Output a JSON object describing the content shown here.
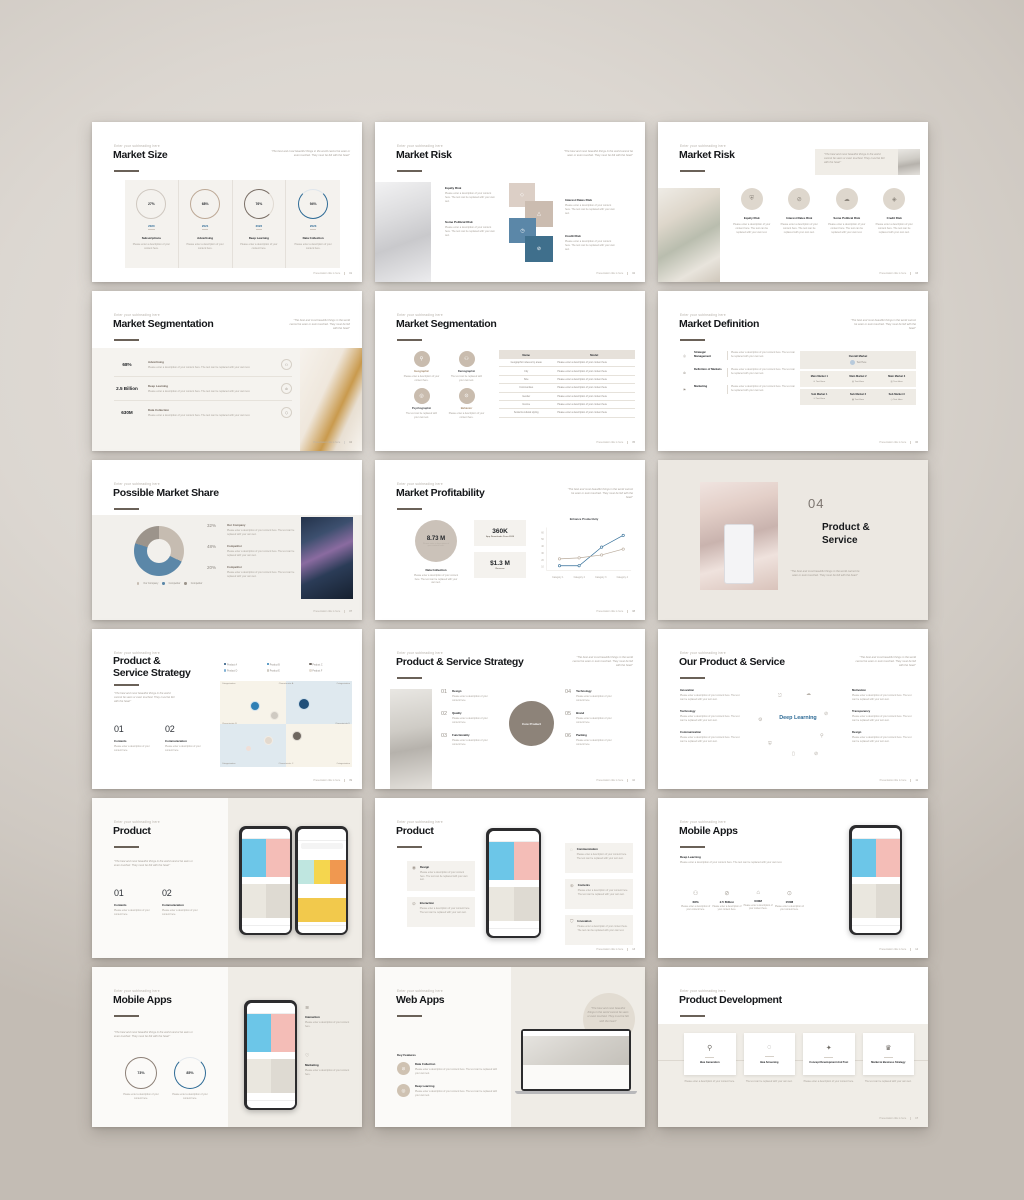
{
  "meta": {
    "eyebrow": "Enter your subheading here",
    "quote": "\"The best and most beautiful things in the world cannot be seen or even touched. They must be felt with the heart\"",
    "body_text": "Please enter a description of your content here. The text can be replaced with your own text.",
    "body_short": "Please enter a description of your content here.",
    "body_alt": "The text can be replaced with your own text.",
    "footer_label": "Presentation title is here",
    "colors": {
      "ink": "#15171a",
      "muted": "#a8a29a",
      "band": "#f3f1ed",
      "accent_blue": "#2e6b96",
      "accent_steel": "#5b87a8",
      "accent_taupe": "#c9bcae",
      "accent_gray": "#8d8880"
    }
  },
  "slides": [
    {
      "id": "market-size",
      "title": "Market Size",
      "page": "01",
      "chart_data": {
        "type": "pie",
        "title": "Market Size",
        "categories": [
          "2020",
          "2021",
          "2022",
          "2023"
        ],
        "labels": [
          "Subscriptions",
          "Advertising",
          "Deep Learning",
          "Data Collection"
        ],
        "values": [
          27,
          68,
          76,
          94
        ],
        "value_labels": [
          "27%",
          "68%",
          "76%",
          "94%"
        ],
        "colors": [
          "#cfc8c0",
          "#bda996",
          "#7a6f66",
          "#2e6b96"
        ]
      }
    },
    {
      "id": "market-risk-a",
      "title": "Market Risk",
      "page": "02",
      "items": [
        {
          "label": "Equity Risk"
        },
        {
          "label": "Some Political Risk"
        },
        {
          "label": "Interest Rates Risk"
        },
        {
          "label": "Credit Risk"
        }
      ],
      "tiles": [
        "#dccfc6",
        "#cbbcb0",
        "#5b87a8",
        "#3f6f8c"
      ]
    },
    {
      "id": "market-risk-b",
      "title": "Market Risk",
      "page": "03",
      "items": [
        {
          "label": "Equity Risk"
        },
        {
          "label": "Interest Rates Risk"
        },
        {
          "label": "Some Political Risk"
        },
        {
          "label": "Credit Risk"
        }
      ]
    },
    {
      "id": "market-segmentation-a",
      "title": "Market Segmentation",
      "page": "04",
      "rows": [
        {
          "value": "68%",
          "label": "Advertising"
        },
        {
          "value": "2.5 Billion",
          "label": "Deep Learning"
        },
        {
          "value": "630M",
          "label": "Data Collection"
        }
      ]
    },
    {
      "id": "market-segmentation-b",
      "title": "Market Segmentation",
      "page": "05",
      "items": [
        {
          "label": "Geographic"
        },
        {
          "label": "Demographic"
        },
        {
          "label": "Psychographic"
        },
        {
          "label": "Behavior"
        }
      ],
      "table": {
        "headers": [
          "Name",
          "Model"
        ],
        "rows": [
          [
            "Geographic indexes by areas",
            "Please enter a description of your content here"
          ],
          [
            "City",
            "Please enter a description of your content here"
          ],
          [
            "Size",
            "Please enter a description of your content here"
          ],
          [
            "Communities",
            "Please enter a description of your content here"
          ],
          [
            "Gender",
            "Please enter a description of your content here"
          ],
          [
            "Income",
            "Please enter a description of your content here"
          ],
          [
            "Social & cultural styling",
            "Please enter a description of your content here"
          ]
        ]
      }
    },
    {
      "id": "market-definition",
      "title": "Market Definition",
      "page": "06",
      "rows": [
        {
          "label": "Strategic Management"
        },
        {
          "label": "Definition of Markets"
        },
        {
          "label": "Marketing"
        }
      ],
      "matrix": {
        "overall": "Overall Market",
        "main": [
          "Main Market 1",
          "Main Market 2",
          "Main Market 3"
        ],
        "sub": [
          "Sub Market 1",
          "Sub Market 2",
          "Sub Market 3"
        ],
        "cell_label": "Text Here"
      }
    },
    {
      "id": "possible-market-share",
      "title": "Possible Market Share",
      "page": "07",
      "chart_data": {
        "type": "pie",
        "title": "Possible Market Share",
        "categories": [
          "Our Company",
          "Competitor",
          "Competitor"
        ],
        "values": [
          32,
          48,
          20
        ],
        "value_labels": [
          "32%",
          "48%",
          "20%"
        ],
        "colors": [
          "#c6bcb1",
          "#5b87a8",
          "#9c948b"
        ],
        "legend": [
          "Our Company",
          "Competitor",
          "Competitor"
        ],
        "legend_position": "bottom"
      }
    },
    {
      "id": "market-profitability",
      "title": "Market Profitability",
      "page": "08",
      "kpis": [
        {
          "value": "8.73 M",
          "label": "Data Collection"
        },
        {
          "value": "360K",
          "label": "App Downloads  From 2020"
        },
        {
          "value": "$1.3 M",
          "label": "Revenue"
        }
      ],
      "chart_data": {
        "type": "line",
        "title": "Enhance Productivity",
        "categories": [
          "Category 1",
          "Category 2",
          "Category 3",
          "Category 4"
        ],
        "series": [
          {
            "name": "Series 1",
            "values": [
              12,
              12,
              40,
              58
            ],
            "color": "#2e6b96"
          },
          {
            "name": "Series 2",
            "values": [
              22,
              23,
              27,
              36
            ],
            "color": "#b9ab9c"
          }
        ],
        "ylim": [
          0,
          65
        ],
        "yticks": [
          10,
          20,
          30,
          40,
          50,
          60
        ],
        "grid": false
      }
    },
    {
      "id": "section-product-service",
      "number": "04",
      "title": "Product & Service",
      "title_lines": [
        "Product &",
        "Service"
      ]
    },
    {
      "id": "product-service-strategy-a",
      "title_lines": [
        "Product &",
        "Service Strategy"
      ],
      "page": "09",
      "legend": [
        "Product A",
        "Product B",
        "Product C",
        "Product D",
        "Product E",
        "Product F"
      ],
      "quadrants": [
        "Categorization",
        "Characteristic A",
        "Categorization",
        "Characteristic B",
        "Characteristic C",
        "Categorization",
        "Characteristic D",
        "Categorization"
      ],
      "items": [
        {
          "num": "01",
          "label": "Contents"
        },
        {
          "num": "02",
          "label": "Communication"
        }
      ]
    },
    {
      "id": "product-service-strategy-b",
      "title": "Product & Service Strategy",
      "page": "10",
      "center": "Core Product",
      "items": [
        {
          "num": "01",
          "label": "Design"
        },
        {
          "num": "02",
          "label": "Quality"
        },
        {
          "num": "03",
          "label": "Functionality"
        },
        {
          "num": "04",
          "label": "Technology"
        },
        {
          "num": "05",
          "label": "Brand"
        },
        {
          "num": "06",
          "label": "Packing"
        }
      ]
    },
    {
      "id": "our-product-service",
      "title": "Our Product & Service",
      "page": "11",
      "center": "Deep Learning",
      "left": [
        {
          "label": "Innovation"
        },
        {
          "label": "Technology"
        },
        {
          "label": "Communication"
        }
      ],
      "right": [
        {
          "label": "Motivation"
        },
        {
          "label": "Transparency"
        },
        {
          "label": "Design"
        }
      ]
    },
    {
      "id": "product-a",
      "title": "Product",
      "page": "12",
      "items": [
        {
          "num": "01",
          "label": "Contents"
        },
        {
          "num": "02",
          "label": "Communication"
        }
      ]
    },
    {
      "id": "product-b",
      "title": "Product",
      "page": "13",
      "left": [
        {
          "label": "Design"
        },
        {
          "label": "Interaction"
        }
      ],
      "right": [
        {
          "label": "Communication"
        },
        {
          "label": "Contents"
        },
        {
          "label": "Innovation"
        }
      ]
    },
    {
      "id": "mobile-apps-a",
      "title": "Mobile Apps",
      "page": "14",
      "subhead": "Deep Learning",
      "stats": [
        {
          "value": "68%"
        },
        {
          "value": "2.5 Billion"
        },
        {
          "value": "630M"
        },
        {
          "value": "150M"
        }
      ]
    },
    {
      "id": "mobile-apps-b",
      "title": "Mobile Apps",
      "page": "15",
      "chart_data": {
        "type": "pie",
        "title": "Mobile Apps",
        "categories": [
          "Ring 1",
          "Ring 2"
        ],
        "values": [
          73,
          85
        ],
        "value_labels": [
          "73%",
          "85%"
        ],
        "colors": [
          "#8d8077",
          "#2e6b96"
        ]
      },
      "items": [
        {
          "label": "Interaction"
        },
        {
          "label": "Marketing"
        }
      ]
    },
    {
      "id": "web-apps",
      "title": "Web Apps",
      "page": "16",
      "subhead": "Key Features",
      "items": [
        {
          "label": "Data Collection"
        },
        {
          "label": "Deep Learning"
        }
      ]
    },
    {
      "id": "product-development",
      "title": "Product Development",
      "page": "17",
      "steps": [
        {
          "label": "Idea Generation",
          "icon": "bulb-icon"
        },
        {
          "label": "Idea Screening",
          "icon": "chat-icon"
        },
        {
          "label": "Concept Development And Test",
          "icon": "rocket-icon"
        },
        {
          "label": "Market & Business Strategy",
          "icon": "crown-icon"
        }
      ]
    }
  ]
}
